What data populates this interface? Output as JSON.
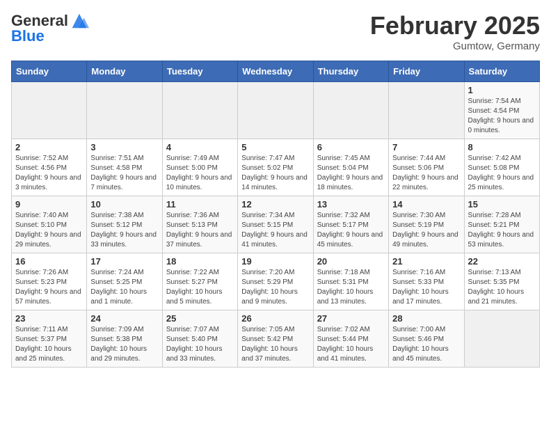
{
  "header": {
    "logo_line1": "General",
    "logo_line2": "Blue",
    "month_title": "February 2025",
    "location": "Gumtow, Germany"
  },
  "weekdays": [
    "Sunday",
    "Monday",
    "Tuesday",
    "Wednesday",
    "Thursday",
    "Friday",
    "Saturday"
  ],
  "weeks": [
    [
      {
        "day": "",
        "info": ""
      },
      {
        "day": "",
        "info": ""
      },
      {
        "day": "",
        "info": ""
      },
      {
        "day": "",
        "info": ""
      },
      {
        "day": "",
        "info": ""
      },
      {
        "day": "",
        "info": ""
      },
      {
        "day": "1",
        "info": "Sunrise: 7:54 AM\nSunset: 4:54 PM\nDaylight: 9 hours and 0 minutes."
      }
    ],
    [
      {
        "day": "2",
        "info": "Sunrise: 7:52 AM\nSunset: 4:56 PM\nDaylight: 9 hours and 3 minutes."
      },
      {
        "day": "3",
        "info": "Sunrise: 7:51 AM\nSunset: 4:58 PM\nDaylight: 9 hours and 7 minutes."
      },
      {
        "day": "4",
        "info": "Sunrise: 7:49 AM\nSunset: 5:00 PM\nDaylight: 9 hours and 10 minutes."
      },
      {
        "day": "5",
        "info": "Sunrise: 7:47 AM\nSunset: 5:02 PM\nDaylight: 9 hours and 14 minutes."
      },
      {
        "day": "6",
        "info": "Sunrise: 7:45 AM\nSunset: 5:04 PM\nDaylight: 9 hours and 18 minutes."
      },
      {
        "day": "7",
        "info": "Sunrise: 7:44 AM\nSunset: 5:06 PM\nDaylight: 9 hours and 22 minutes."
      },
      {
        "day": "8",
        "info": "Sunrise: 7:42 AM\nSunset: 5:08 PM\nDaylight: 9 hours and 25 minutes."
      }
    ],
    [
      {
        "day": "9",
        "info": "Sunrise: 7:40 AM\nSunset: 5:10 PM\nDaylight: 9 hours and 29 minutes."
      },
      {
        "day": "10",
        "info": "Sunrise: 7:38 AM\nSunset: 5:12 PM\nDaylight: 9 hours and 33 minutes."
      },
      {
        "day": "11",
        "info": "Sunrise: 7:36 AM\nSunset: 5:13 PM\nDaylight: 9 hours and 37 minutes."
      },
      {
        "day": "12",
        "info": "Sunrise: 7:34 AM\nSunset: 5:15 PM\nDaylight: 9 hours and 41 minutes."
      },
      {
        "day": "13",
        "info": "Sunrise: 7:32 AM\nSunset: 5:17 PM\nDaylight: 9 hours and 45 minutes."
      },
      {
        "day": "14",
        "info": "Sunrise: 7:30 AM\nSunset: 5:19 PM\nDaylight: 9 hours and 49 minutes."
      },
      {
        "day": "15",
        "info": "Sunrise: 7:28 AM\nSunset: 5:21 PM\nDaylight: 9 hours and 53 minutes."
      }
    ],
    [
      {
        "day": "16",
        "info": "Sunrise: 7:26 AM\nSunset: 5:23 PM\nDaylight: 9 hours and 57 minutes."
      },
      {
        "day": "17",
        "info": "Sunrise: 7:24 AM\nSunset: 5:25 PM\nDaylight: 10 hours and 1 minute."
      },
      {
        "day": "18",
        "info": "Sunrise: 7:22 AM\nSunset: 5:27 PM\nDaylight: 10 hours and 5 minutes."
      },
      {
        "day": "19",
        "info": "Sunrise: 7:20 AM\nSunset: 5:29 PM\nDaylight: 10 hours and 9 minutes."
      },
      {
        "day": "20",
        "info": "Sunrise: 7:18 AM\nSunset: 5:31 PM\nDaylight: 10 hours and 13 minutes."
      },
      {
        "day": "21",
        "info": "Sunrise: 7:16 AM\nSunset: 5:33 PM\nDaylight: 10 hours and 17 minutes."
      },
      {
        "day": "22",
        "info": "Sunrise: 7:13 AM\nSunset: 5:35 PM\nDaylight: 10 hours and 21 minutes."
      }
    ],
    [
      {
        "day": "23",
        "info": "Sunrise: 7:11 AM\nSunset: 5:37 PM\nDaylight: 10 hours and 25 minutes."
      },
      {
        "day": "24",
        "info": "Sunrise: 7:09 AM\nSunset: 5:38 PM\nDaylight: 10 hours and 29 minutes."
      },
      {
        "day": "25",
        "info": "Sunrise: 7:07 AM\nSunset: 5:40 PM\nDaylight: 10 hours and 33 minutes."
      },
      {
        "day": "26",
        "info": "Sunrise: 7:05 AM\nSunset: 5:42 PM\nDaylight: 10 hours and 37 minutes."
      },
      {
        "day": "27",
        "info": "Sunrise: 7:02 AM\nSunset: 5:44 PM\nDaylight: 10 hours and 41 minutes."
      },
      {
        "day": "28",
        "info": "Sunrise: 7:00 AM\nSunset: 5:46 PM\nDaylight: 10 hours and 45 minutes."
      },
      {
        "day": "",
        "info": ""
      }
    ]
  ]
}
